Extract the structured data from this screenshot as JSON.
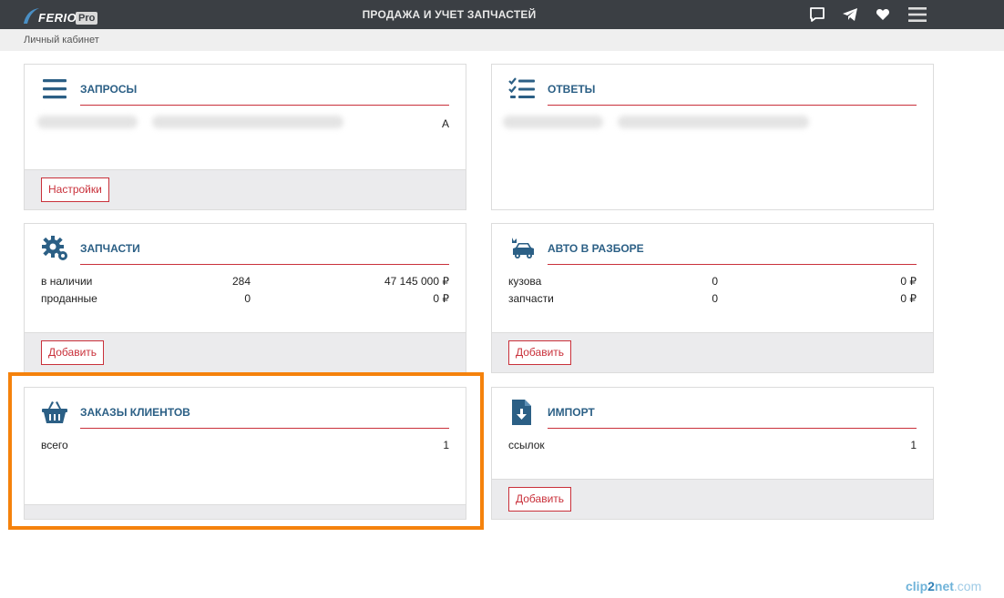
{
  "header": {
    "logo_text": "FERIO",
    "logo_badge": "Pro",
    "title": "ПРОДАЖА И УЧЕТ ЗАПЧАСТЕЙ",
    "icons": [
      "chat-icon",
      "telegram-icon",
      "heart-icon",
      "menu-icon"
    ]
  },
  "breadcrumb": "Личный кабинет",
  "cards": {
    "requests": {
      "title": "ЗАПРОСЫ",
      "icon": "list-icon",
      "visible_value": "А",
      "button": "Настройки"
    },
    "answers": {
      "title": "ОТВЕТЫ",
      "icon": "checklist-icon"
    },
    "parts": {
      "title": "ЗАПЧАСТИ",
      "icon": "gear-icon",
      "rows": [
        {
          "label": "в наличии",
          "count": "284",
          "sum": "47 145 000 ₽"
        },
        {
          "label": "проданные",
          "count": "0",
          "sum": "0 ₽"
        }
      ],
      "button": "Добавить"
    },
    "cars": {
      "title": "АВТО В РАЗБОРЕ",
      "icon": "car-crash-icon",
      "rows": [
        {
          "label": "кузова",
          "count": "0",
          "sum": "0 ₽"
        },
        {
          "label": "запчасти",
          "count": "0",
          "sum": "0 ₽"
        }
      ],
      "button": "Добавить"
    },
    "orders": {
      "title": "ЗАКАЗЫ КЛИЕНТОВ",
      "icon": "basket-icon",
      "rows": [
        {
          "label": "всего",
          "count": "1"
        }
      ]
    },
    "import": {
      "title": "ИМПОРТ",
      "icon": "file-download-icon",
      "rows": [
        {
          "label": "ссылок",
          "count": "1"
        }
      ],
      "button": "Добавить"
    }
  },
  "colors": {
    "topbar": "#3b3f44",
    "title_blue": "#2b5f85",
    "accent_red": "#c9303a",
    "highlight_orange": "#f5820c"
  },
  "watermark": {
    "part1": "clip",
    "part2": "2",
    "part3": "net",
    "part4": ".com"
  }
}
